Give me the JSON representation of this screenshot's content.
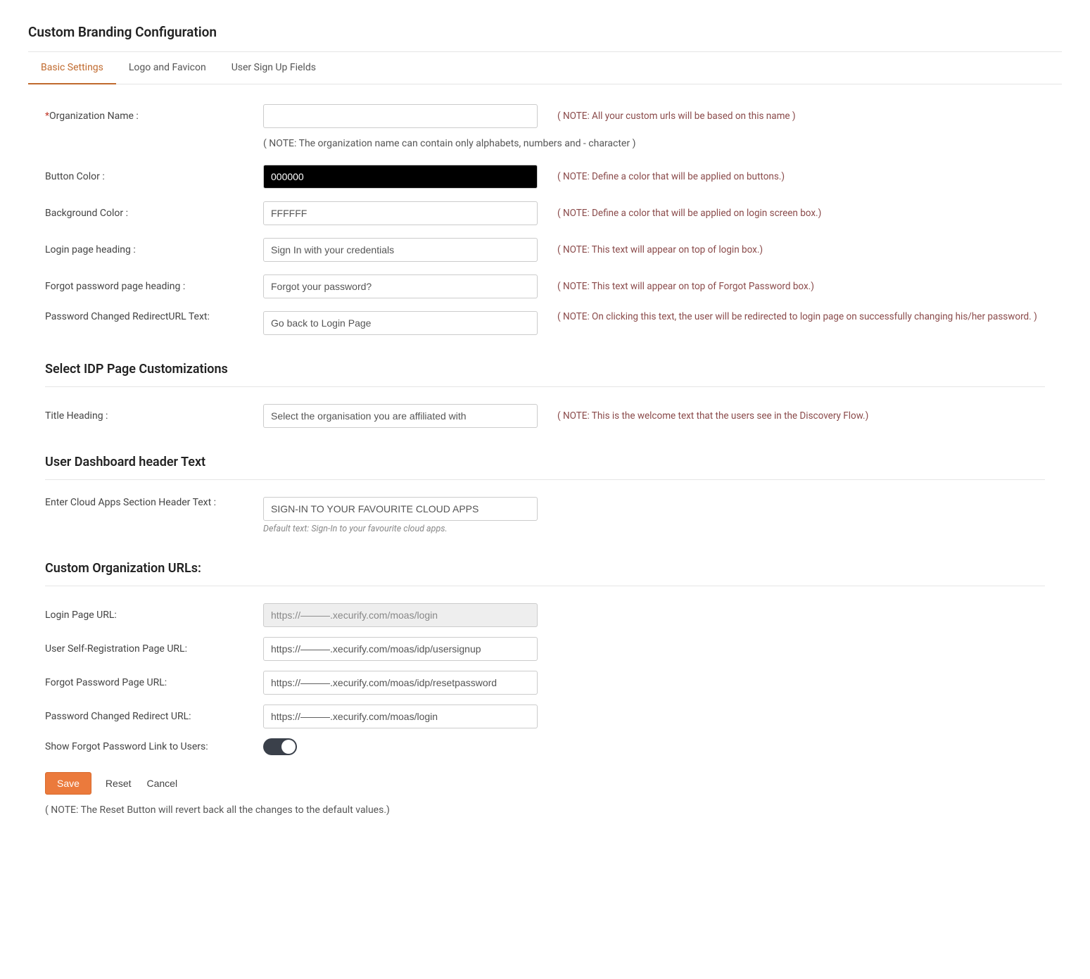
{
  "pageTitle": "Custom Branding Configuration",
  "tabs": [
    {
      "label": "Basic Settings",
      "active": true
    },
    {
      "label": "Logo and Favicon",
      "active": false
    },
    {
      "label": "User Sign Up Fields",
      "active": false
    }
  ],
  "fields": {
    "orgName": {
      "label": "Organization Name :",
      "value": "",
      "note": "( NOTE: All your custom urls will be based on this name )"
    },
    "orgSubNote": "( NOTE: The organization name can contain only alphabets, numbers and - character )",
    "buttonColor": {
      "label": "Button Color :",
      "value": "000000",
      "note": "( NOTE: Define a color that will be applied on buttons.)"
    },
    "bgColor": {
      "label": "Background Color :",
      "value": "FFFFFF",
      "note": "( NOTE: Define a color that will be applied on login screen box.)"
    },
    "loginHeading": {
      "label": "Login page heading :",
      "value": "Sign In with your credentials",
      "note": "( NOTE: This text will appear on top of login box.)"
    },
    "forgotHeading": {
      "label": "Forgot password page heading :",
      "value": "Forgot your password?",
      "note": "( NOTE: This text will appear on top of Forgot Password box.)"
    },
    "pwdChangedText": {
      "label": "Password Changed RedirectURL Text:",
      "value": "Go back to Login Page",
      "note": "( NOTE: On clicking this text, the user will be redirected to login page on successfully changing his/her password. )"
    }
  },
  "idpSection": {
    "heading": "Select IDP Page Customizations",
    "titleHeading": {
      "label": "Title Heading :",
      "value": "Select the organisation you are affiliated with",
      "note": "( NOTE: This is the welcome text that the users see in the Discovery Flow.)"
    }
  },
  "dashboardSection": {
    "heading": "User Dashboard header Text",
    "cloudApps": {
      "label": "Enter Cloud Apps Section Header Text :",
      "value": "SIGN-IN TO YOUR FAVOURITE CLOUD APPS",
      "help": "Default text: Sign-In to your favourite cloud apps."
    }
  },
  "urlsSection": {
    "heading": "Custom Organization URLs:",
    "loginUrl": {
      "label": "Login Page URL:",
      "value": "https://———.xecurify.com/moas/login"
    },
    "signupUrl": {
      "label": "User Self-Registration Page URL:",
      "value": "https://———.xecurify.com/moas/idp/usersignup"
    },
    "forgotUrl": {
      "label": "Forgot Password Page URL:",
      "value": "https://———.xecurify.com/moas/idp/resetpassword"
    },
    "pwdChangedUrl": {
      "label": "Password Changed Redirect URL:",
      "value": "https://———.xecurify.com/moas/login"
    },
    "showForgot": {
      "label": "Show Forgot Password Link to Users:"
    }
  },
  "actions": {
    "save": "Save",
    "reset": "Reset",
    "cancel": "Cancel",
    "footerNote": "( NOTE: The Reset Button will revert back all the changes to the default values.)"
  }
}
